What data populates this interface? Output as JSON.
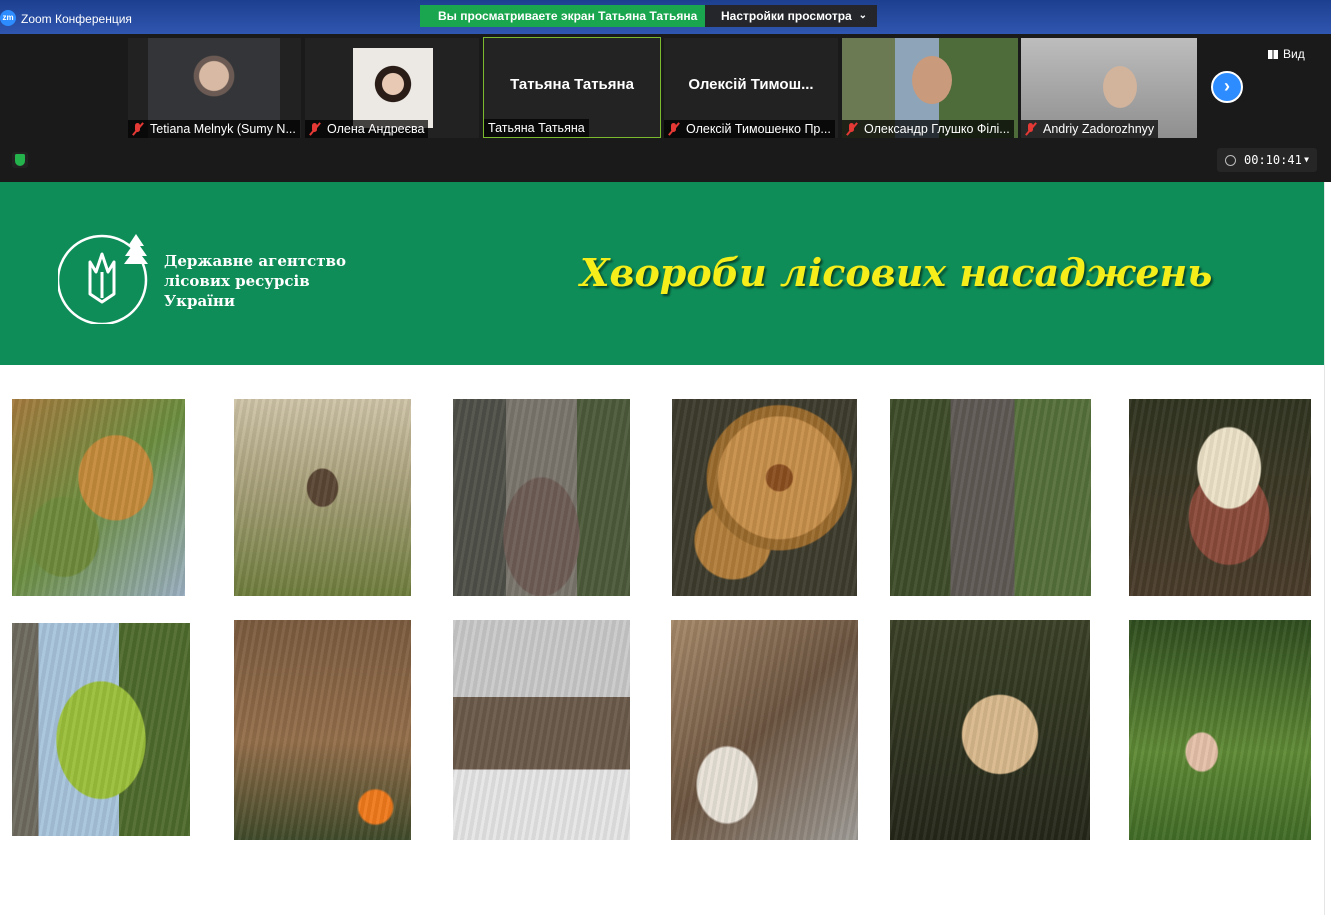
{
  "window": {
    "title": "Zoom Конференция",
    "logo_text": "zm"
  },
  "share_banner": {
    "text": "Вы просматриваете экран Татьяна Татьяна",
    "view_settings_label": "Настройки просмотра"
  },
  "participants": [
    {
      "name": "Tetiana Melnyk (Sumy N...",
      "muted": true
    },
    {
      "name": "Олена Андреєва",
      "muted": true
    },
    {
      "name": "Татьяна Татьяна",
      "big_name": "Татьяна Татьяна",
      "muted": false,
      "active": true
    },
    {
      "name": "Олексій Тимошенко Пр...",
      "big_name": "Олексій Тимош...",
      "muted": true
    },
    {
      "name": "Олександр Глушко Філі...",
      "muted": true
    },
    {
      "name": "Andriy Zadorozhnyy",
      "muted": true
    }
  ],
  "toolbar": {
    "view_label": "Вид",
    "timer": "00:10:41",
    "next_icon": "chevron-right-icon"
  },
  "slide": {
    "org_name_lines": [
      "Державне агентство",
      "лісових ресурсів",
      "України"
    ],
    "title": "Хвороби лісових насаджень",
    "header_color": "#0e8d59",
    "title_color": "#f5ee1a"
  }
}
